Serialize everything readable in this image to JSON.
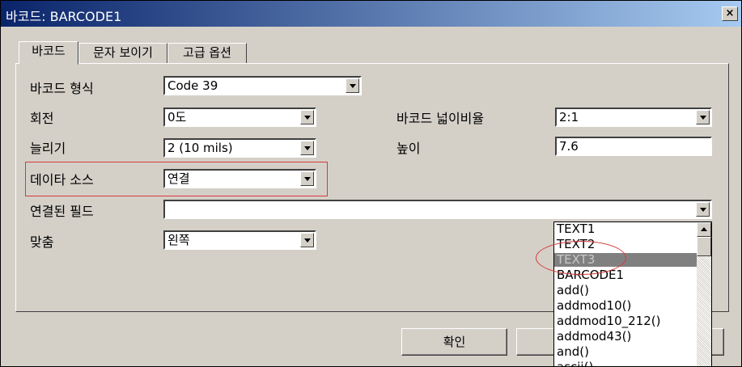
{
  "window": {
    "title": "바코드: BARCODE1",
    "close_label": "×"
  },
  "tabs": [
    {
      "label": "바코드"
    },
    {
      "label": "문자 보이기"
    },
    {
      "label": "고급 옵션"
    }
  ],
  "fields": {
    "barcode_type": {
      "label": "바코드 형식",
      "value": "Code 39"
    },
    "rotation": {
      "label": "회전",
      "value": "0도"
    },
    "stretch": {
      "label": "늘리기",
      "value": "2  (10 mils)"
    },
    "data_source": {
      "label": "데이타 소스",
      "value": "연결"
    },
    "linked_field": {
      "label": "연결된 필드",
      "value": ""
    },
    "align": {
      "label": "맞춤",
      "value": "왼쪽"
    },
    "ratio": {
      "label": "바코드 넓이비율",
      "value": "2:1"
    },
    "height": {
      "label": "높이",
      "value": "7.6"
    }
  },
  "dropdown": {
    "items": [
      "TEXT1",
      "TEXT2",
      "TEXT3",
      "BARCODE1",
      "add()",
      "addmod10()",
      "addmod10_212()",
      "addmod43()",
      "and()",
      "ascii()"
    ],
    "selected_index": 2
  },
  "buttons": {
    "ok": "확인"
  },
  "annotation_color": "#d63a3a"
}
